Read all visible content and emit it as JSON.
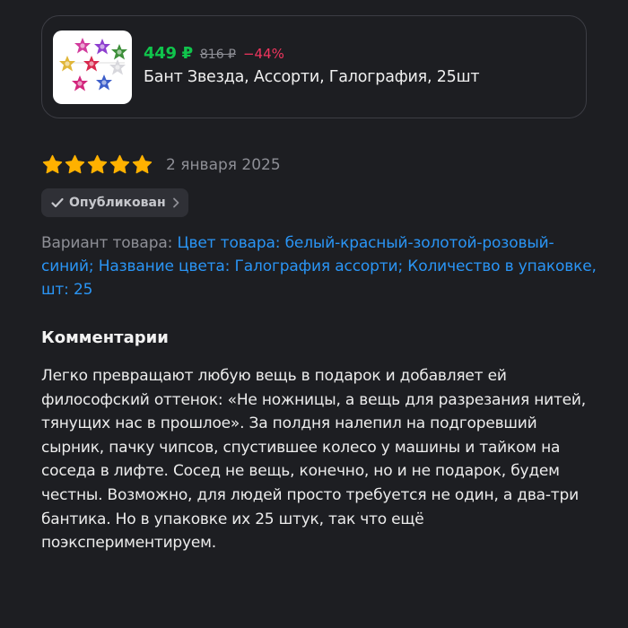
{
  "product": {
    "image_icon": "gift-bows-image",
    "price_current": "449 ₽",
    "price_old": "816 ₽",
    "discount": "−44%",
    "title": "Бант Звезда, Ассорти, Галография, 25шт"
  },
  "review": {
    "rating": 5,
    "rating_max": 5,
    "date": "2 января 2025",
    "status": "Опубликован",
    "variant_label": "Вариант товара: ",
    "variant_value": "Цвет товара: белый-красный-золотой-розовый-синий; Название цвета: Галография ассорти; Количество в упаковке, шт: 25",
    "comments_heading": "Комментарии",
    "comment": "Легко превращают любую вещь в подарок и добавляет ей философский оттенок: «Не ножницы, а вещь для разрезания нитей, тянущих нас в прошлое». За полдня налепил на подгоревший сырник, пачку чипсов, спустившее колесо у машины и тайком на соседа в лифте. Сосед не вещь, конечно, но и не подарок, будем честны. Возможно, для людей просто требуется не один, а два-три бантика. Но в упаковке их 25 штук, так что ещё поэкспериментируем."
  },
  "colors": {
    "background": "#1d1e22",
    "price_green": "#10c44c",
    "discount_red": "#f0355e",
    "link_blue": "#2a95f5",
    "star_gold": "#ffb100",
    "muted_gray": "#8e8f96"
  }
}
